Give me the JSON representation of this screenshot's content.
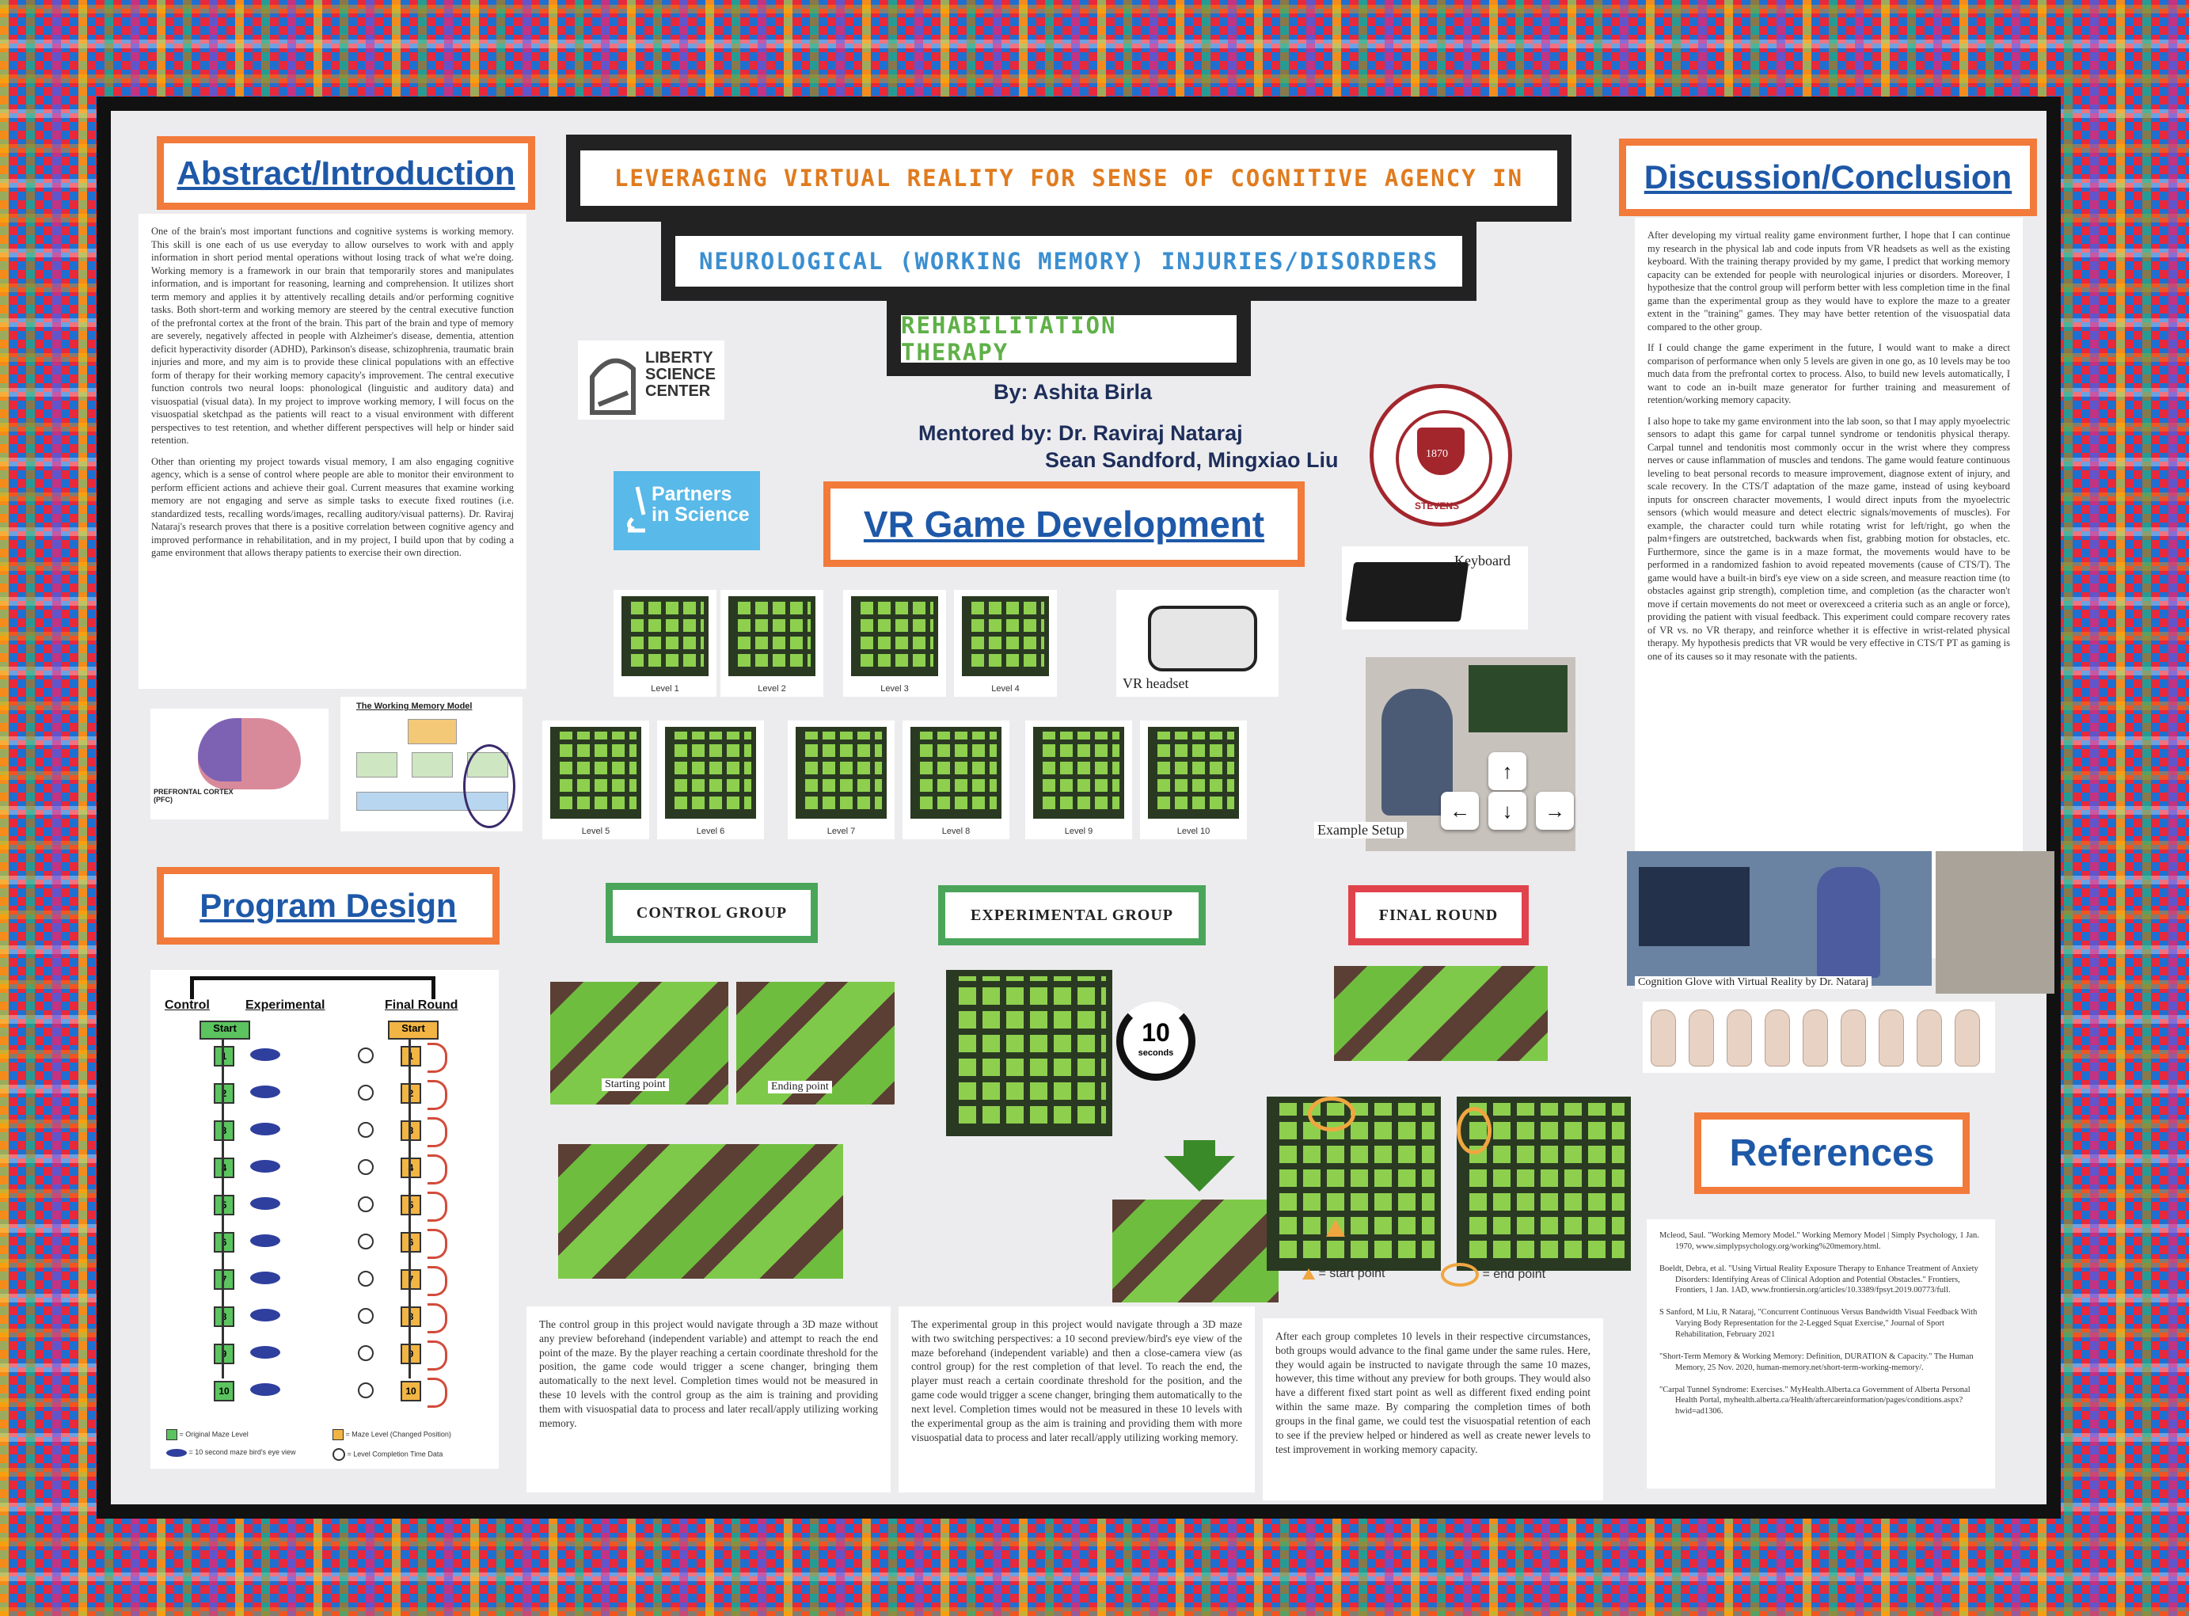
{
  "title": {
    "line1": "LEVERAGING VIRTUAL REALITY FOR SENSE OF COGNITIVE AGENCY IN",
    "line2": "NEUROLOGICAL (WORKING MEMORY) INJURIES/DISORDERS",
    "line3": "REHABILITATION THERAPY"
  },
  "author": "By: Ashita Birla",
  "mentor_line1": "Mentored by: Dr. Raviraj Nataraj",
  "mentor_line2": "Sean Sandford, Mingxiao Liu",
  "logos": {
    "liberty": [
      "LIBERTY",
      "SCIENCE",
      "CENTER"
    ],
    "partners": [
      "Partners",
      "in Science"
    ],
    "seal_year": "1870",
    "seal_name": "STEVENS"
  },
  "abstract": {
    "header": "Abstract/Introduction",
    "p1": "One of the brain's most important functions and cognitive systems is working memory. This skill is one each of us use everyday to allow ourselves to work with and apply information in short period mental operations without losing track of what we're doing. Working memory is a framework in our brain that temporarily stores and manipulates information, and is important for reasoning, learning and comprehension. It utilizes short term memory and applies it by attentively recalling details and/or performing cognitive tasks. Both short-term and working memory are steered by the central executive function of the prefrontal cortex at the front of the brain. This part of the brain and type of memory are severely, negatively affected in people with Alzheimer's disease, dementia, attention deficit hyperactivity disorder (ADHD), Parkinson's disease, schizophrenia, traumatic brain injuries and more, and my aim is to provide these clinical populations with an effective form of therapy for their working memory capacity's improvement. The central executive function controls two neural loops: phonological (linguistic and auditory data) and visuospatial (visual data). In my project to improve working memory, I will focus on the visuospatial sketchpad as the patients will react to a visual environment with different perspectives to test retention, and whether different perspectives will help or hinder said retention.",
    "p2": "Other than orienting my project towards visual memory, I am also engaging cognitive agency, which is a sense of control where people are able to monitor their environment to perform efficient actions and achieve their goal. Current measures that examine working memory are not engaging and serve as simple tasks to execute fixed routines (i.e. standardized tests, recalling words/images, recalling auditory/visual patterns). Dr. Raviraj Nataraj's research proves that there is a positive correlation between cognitive agency and improved performance in rehabilitation, and in my project, I build upon that by coding a game environment that allows therapy patients to exercise their own direction.",
    "brain_label": "PREFRONTAL CORTEX (PFC)",
    "model_title": "The Working Memory Model"
  },
  "program_design": {
    "header": "Program Design",
    "col_control": "Control",
    "col_experimental": "Experimental",
    "col_final": "Final Round",
    "start": "Start",
    "levels": [
      "1",
      "2",
      "3",
      "4",
      "5",
      "6",
      "7",
      "8",
      "9",
      "10"
    ],
    "legend1": "= Original Maze Level",
    "legend2": "= 10 second maze bird's eye view",
    "legend3": "= Maze Level (Changed Position)",
    "legend4": "= Level Completion Time Data"
  },
  "vr": {
    "header": "VR Game Development",
    "levels": [
      "Level 1",
      "Level 2",
      "Level 3",
      "Level 4",
      "Level 5",
      "Level 6",
      "Level 7",
      "Level 8",
      "Level 9",
      "Level 10"
    ],
    "headset": "VR headset",
    "keyboard": "Keyboard",
    "setup": "Example Setup",
    "arrows": [
      "↑",
      "←",
      "↓",
      "→"
    ]
  },
  "groups": {
    "control": "CONTROL GROUP",
    "experimental": "EXPERIMENTAL GROUP",
    "final": "FINAL ROUND",
    "starting_point": "Starting point",
    "ending_point": "Ending point",
    "timer_num": "10",
    "timer_unit": "seconds",
    "start_legend": "= start point",
    "end_legend": "= end point",
    "control_text": "The control group in this project would navigate through a 3D maze without any preview beforehand (independent variable) and attempt to reach the end point of the maze. By the player reaching a certain coordinate threshold for the position, the game code would trigger a scene changer, bringing them automatically to the next level. Completion times would not be measured in these 10 levels with the control group as the aim is training and providing them with visuospatial data to process and later recall/apply utilizing working memory.",
    "experimental_text": "The experimental group in this project would navigate through a 3D maze with two switching perspectives: a 10 second preview/bird's eye view of the maze beforehand (independent variable) and then a close-camera view (as control group) for the rest completion of that level. To reach the end, the player must reach a certain coordinate threshold for the position, and the game code would trigger a scene changer, bringing them automatically to the next level. Completion times would not be measured in these 10 levels with the experimental group as the aim is training and providing them with more visuospatial data to process and later recall/apply utilizing working memory.",
    "final_text": "After each group completes 10 levels in their respective circumstances, both groups would advance to the final game under the same rules. Here, they would again be instructed to navigate through the same 10 mazes, however, this time without any preview for both groups. They would also have a different fixed start point as well as different fixed ending point within the same maze. By comparing the completion times of both groups in the final game, we could test the visuospatial retention of each to see if the preview helped or hindered as well as create newer levels to test improvement in working memory capacity."
  },
  "discussion": {
    "header": "Discussion/Conclusion",
    "p1": "After developing my virtual reality game environment further, I hope that I can continue my research in the physical lab and code inputs from VR headsets as well as the existing keyboard. With the training therapy provided by my game, I predict that working memory capacity can be extended for people with neurological injuries or disorders. Moreover, I hypothesize that the control group will perform better with less completion time in the final game than the experimental group as they would have to explore the maze to a greater extent in the \"training\" games. They may have better retention of the visuospatial data compared to the other group.",
    "p2": "If I could change the game experiment in the future, I would want to make a direct comparison of performance when only 5 levels are given in one go, as 10 levels may be too much data from the prefrontal cortex to process. Also, to build new levels automatically, I want to code an in-built maze generator for further training and measurement of retention/working memory capacity.",
    "p3": "I also hope to take my game environment into the lab soon, so that I may apply myoelectric sensors to adapt this game for carpal tunnel syndrome or tendonitis physical therapy. Carpal tunnel and tendonitis most commonly occur in the wrist where they compress nerves or cause inflammation of muscles and tendons. The game would feature continuous leveling to beat personal records to measure improvement, diagnose extent of injury, and scale recovery. In the CTS/T adaptation of the maze game, instead of using keyboard inputs for onscreen character movements, I would direct inputs from the myoelectric sensors (which would measure and detect electric signals/movements of muscles). For example, the character could turn while rotating wrist for left/right, go when the palm+fingers are outstretched, backwards when fist, grabbing motion for obstacles, etc. Furthermore, since the game is in a maze format, the movements would have to be performed in a randomized fashion to avoid repeated movements (cause of CTS/T). The game would have a built-in bird's eye view on a side screen, and measure reaction time (to obstacles against grip strength), completion time, and completion (as the character won't move if certain movements do not meet or overexceed a criteria such as an angle or force), providing the patient with visual feedback. This experiment could compare recovery rates of VR vs. no VR therapy, and reinforce whether it is effective in wrist-related physical therapy. My hypothesis predicts that VR would be very effective in CTS/T PT as gaming is one of its causes so it may resonate with the patients.",
    "glove_caption": "Cognition Glove with Virtual Reality by Dr. Nataraj"
  },
  "references": {
    "header": "References",
    "items": [
      "Mcleod, Saul. \"Working Memory Model.\" Working Memory Model | Simply Psychology, 1 Jan. 1970, www.simplypsychology.org/working%20memory.html.",
      "Boeldt, Debra, et al. \"Using Virtual Reality Exposure Therapy to Enhance Treatment of Anxiety Disorders: Identifying Areas of Clinical Adoption and Potential Obstacles.\" Frontiers, Frontiers, 1 Jan. 1AD, www.frontiersin.org/articles/10.3389/fpsyt.2019.00773/full.",
      "S Sanford, M Liu, R Nataraj, \"Concurrent Continuous Versus Bandwidth Visual Feedback With Varying Body Representation for the 2-Legged Squat Exercise,\" Journal of Sport Rehabilitation, February 2021",
      "\"Short-Term Memory & Working Memory: Definition, DURATION & Capacity.\" The Human Memory, 25 Nov. 2020, human-memory.net/short-term-working-memory/.",
      "\"Carpal Tunnel Syndrome: Exercises.\" MyHealth.Alberta.ca Government of Alberta Personal Health Portal, myhealth.alberta.ca/Health/aftercareinformation/pages/conditions.aspx?hwid=ad1306."
    ]
  },
  "colors": {
    "orange_border": "#f27a3a",
    "header_blue": "#1e58a8",
    "green_border": "#4aa55a",
    "red_border": "#e0434c"
  }
}
